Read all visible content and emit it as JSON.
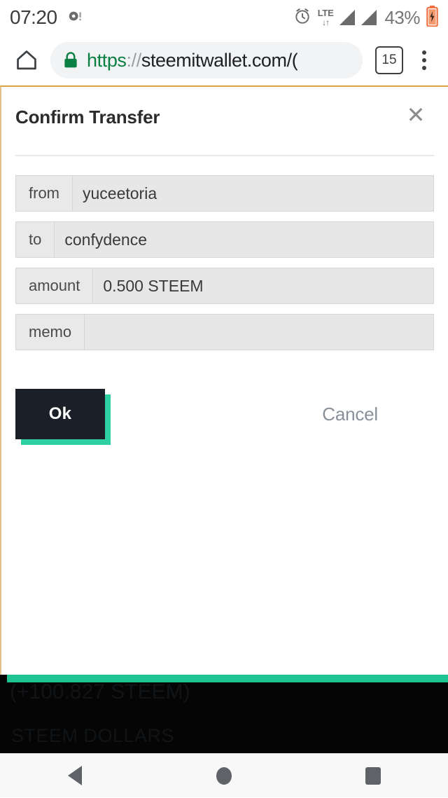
{
  "status_bar": {
    "time": "07:20",
    "notification_icon": "camera-notification-icon",
    "alarm_icon": "alarm-clock-icon",
    "network_type": "LTE",
    "network_arrows": "↓↑",
    "signal_icon_1": "signal-bars-icon",
    "signal_icon_2": "signal-bars-icon",
    "battery_percent": "43%",
    "battery_icon": "battery-charging-icon"
  },
  "browser": {
    "home_icon": "home-icon",
    "lock_icon": "lock-icon",
    "url_scheme": "https",
    "url_separator": "://",
    "url_host": "steemitwallet.com/(",
    "url_full": "https://steemitwallet.com/(",
    "tab_count": "15",
    "menu_icon": "more-vertical-icon"
  },
  "dialog": {
    "title": "Confirm Transfer",
    "close_label": "✕",
    "fields": [
      {
        "label": "from",
        "value": "yuceetoria",
        "name": "from"
      },
      {
        "label": "to",
        "value": "confydence",
        "name": "to"
      },
      {
        "label": "amount",
        "value": "0.500 STEEM",
        "name": "amount"
      },
      {
        "label": "memo",
        "value": "",
        "name": "memo"
      }
    ],
    "ok_label": "Ok",
    "cancel_label": "Cancel",
    "accent_color": "#2ecfa0",
    "button_color": "#1b2028",
    "border_color": "#d9a441"
  },
  "background_page": {
    "ghost_line_1": "(+100.827 STEEM)",
    "ghost_line_2": "STEEM DOLLARS",
    "bar_color": "#1ec592"
  },
  "navigation": {
    "back_icon": "back-triangle-icon",
    "home_icon": "home-circle-icon",
    "recents_icon": "recents-square-icon"
  }
}
